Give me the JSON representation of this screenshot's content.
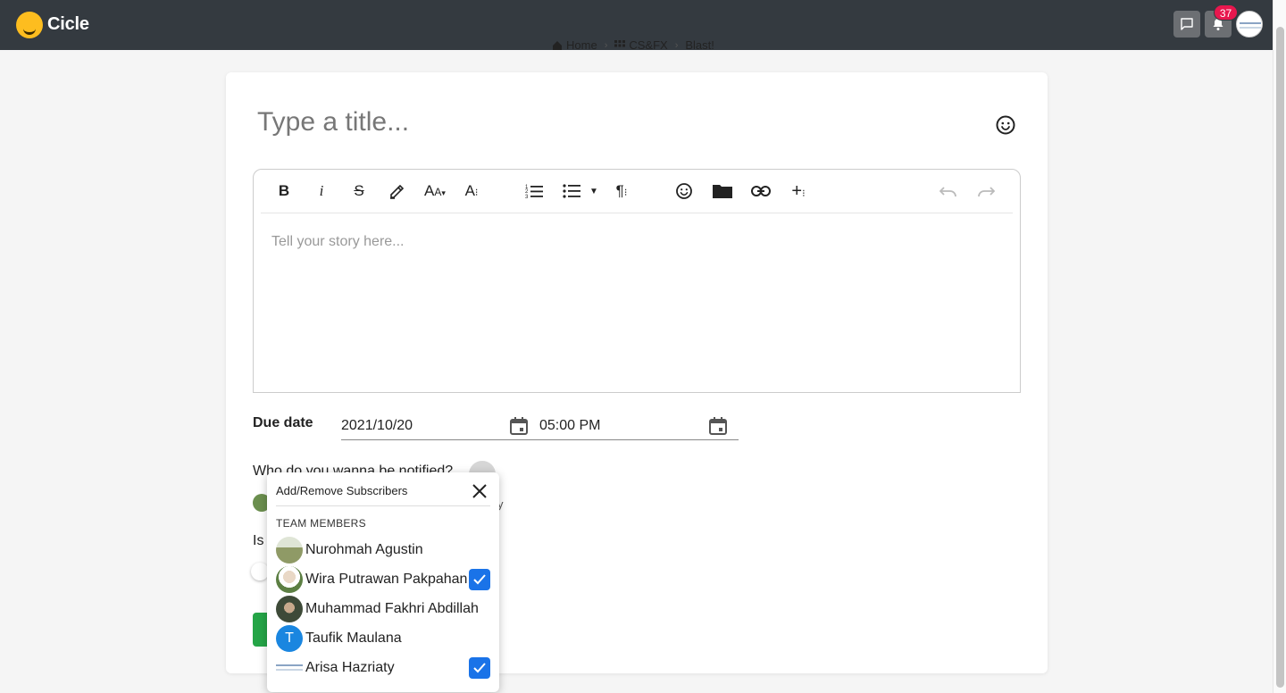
{
  "header": {
    "brand": "Cicle",
    "notification_count": "37"
  },
  "breadcrumb": {
    "items": [
      "Home",
      "CS&FX",
      "Blast!"
    ]
  },
  "post": {
    "title_placeholder": "Type a title...",
    "body_placeholder": "Tell your story here..."
  },
  "toolbar": {
    "tools": [
      "bold-icon",
      "italic-icon",
      "strikethrough-icon",
      "highlight-icon",
      "font-size-icon",
      "line-height-icon",
      "ordered-list-icon",
      "unordered-list-icon",
      "paragraph-icon",
      "emoji-icon",
      "folder-icon",
      "link-icon",
      "insert-more-icon",
      "undo-icon",
      "redo-icon"
    ]
  },
  "due": {
    "label": "Due date",
    "date": "2021/10/20",
    "time": "05:00 PM"
  },
  "notify": {
    "label": "Who do you wanna be notified?",
    "subscriber_tail": "y",
    "private_label": "Is"
  },
  "subscribers_popup": {
    "title": "Add/Remove Subscribers",
    "section": "TEAM MEMBERS",
    "members": [
      {
        "name": "Nurohmah Agustin",
        "checked": false,
        "avatar_color": "#9aa67a"
      },
      {
        "name": "Wira Putrawan Pakpahan",
        "checked": true,
        "avatar_color": "#6b8f4e"
      },
      {
        "name": "Muhammad Fakhri Abdillah",
        "checked": false,
        "avatar_color": "#4f5a48"
      },
      {
        "name": "Taufik Maulana",
        "checked": false,
        "avatar_color": "#1a86e0",
        "initial": "T"
      },
      {
        "name": "Arisa Hazriaty",
        "checked": true,
        "avatar_color": "#e9eef4"
      }
    ]
  },
  "colors": {
    "topbar": "#343a40",
    "badge": "#e8174e",
    "accent": "#1a73e8",
    "publish": "#25a547"
  }
}
